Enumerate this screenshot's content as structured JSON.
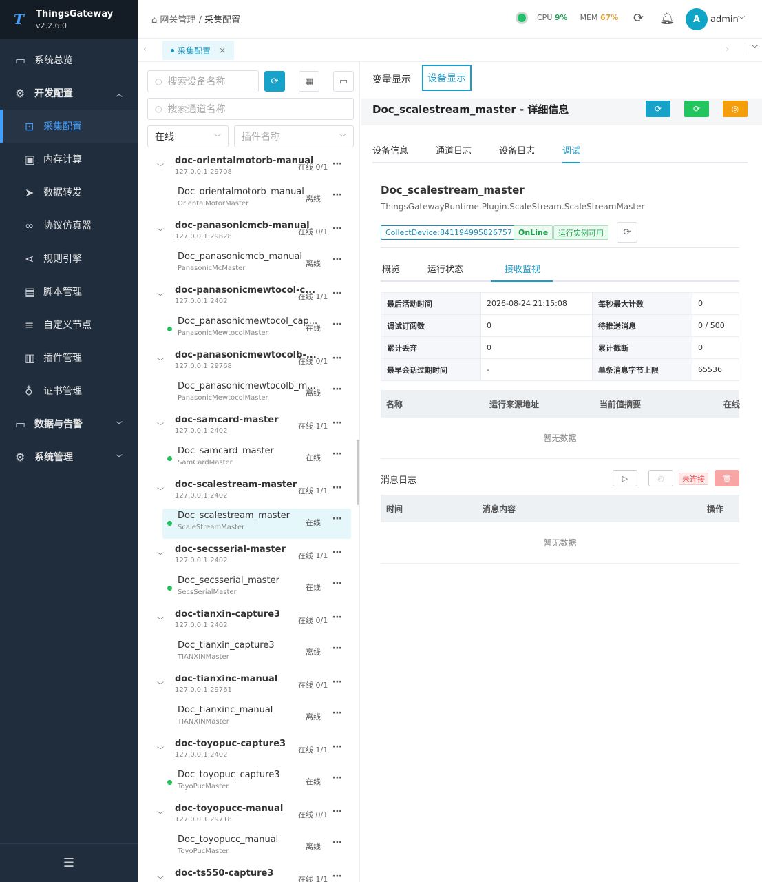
{
  "app": {
    "name": "ThingsGateway",
    "version": "v2.2.6.0",
    "logo": "T"
  },
  "nav": [
    {
      "id": "overview",
      "label": "系统总览",
      "icon": "monitor-icon",
      "level": "top"
    },
    {
      "id": "devconfig",
      "label": "开发配置",
      "icon": "gear-icon",
      "level": "top",
      "expanded": true
    },
    {
      "id": "collect",
      "label": "采集配置",
      "icon": "chart-screen-icon",
      "level": "sub",
      "active": true
    },
    {
      "id": "memcalc",
      "label": "内存计算",
      "icon": "chip-icon",
      "level": "sub"
    },
    {
      "id": "forward",
      "label": "数据转发",
      "icon": "send-icon",
      "level": "sub"
    },
    {
      "id": "simulator",
      "label": "协议仿真器",
      "icon": "link-icon",
      "level": "sub"
    },
    {
      "id": "rules",
      "label": "规则引擎",
      "icon": "share-icon",
      "level": "sub"
    },
    {
      "id": "scripts",
      "label": "脚本管理",
      "icon": "file-icon",
      "level": "sub"
    },
    {
      "id": "customnode",
      "label": "自定义节点",
      "icon": "sliders-icon",
      "level": "sub"
    },
    {
      "id": "plugins",
      "label": "插件管理",
      "icon": "package-icon",
      "level": "sub"
    },
    {
      "id": "certs",
      "label": "证书管理",
      "icon": "stamp-icon",
      "level": "sub"
    },
    {
      "id": "dataalarm",
      "label": "数据与告警",
      "icon": "chart-board-icon",
      "level": "top",
      "collapsed": true
    },
    {
      "id": "sysmgmt",
      "label": "系统管理",
      "icon": "settings-icon",
      "level": "top",
      "collapsed": true
    }
  ],
  "header": {
    "crumb_root": "网关管理",
    "crumb_sep": "/",
    "crumb_current": "采集配置",
    "cpu_label": "CPU",
    "cpu_value": "9%",
    "mem_label": "MEM",
    "mem_value": "67%",
    "user_initial": "A",
    "user_name": "admin"
  },
  "tab": {
    "label": "采集配置"
  },
  "filters": {
    "device_search": "搜索设备名称",
    "channel_search": "搜索通道名称",
    "status_select": "在线",
    "plugin_select": "插件名称"
  },
  "tree": [
    {
      "name": "doc-orientalmotorb-manual",
      "addr": "127.0.0.1:29708",
      "stat": "在线 0/1",
      "dev": {
        "name": "Doc_orientalmotorb_manual",
        "plugin": "OrientalMotorMaster",
        "status": "离线",
        "online": false
      }
    },
    {
      "name": "doc-panasonicmcb-manual",
      "addr": "127.0.0.1:29828",
      "stat": "在线 0/1",
      "dev": {
        "name": "Doc_panasonicmcb_manual",
        "plugin": "PanasonicMcMaster",
        "status": "离线",
        "online": false
      }
    },
    {
      "name": "doc-panasonicmewtocol-c...",
      "addr": "127.0.0.1:2402",
      "stat": "在线 1/1",
      "dev": {
        "name": "Doc_panasonicmewtocol_cap...",
        "plugin": "PanasonicMewtocolMaster",
        "status": "在线",
        "online": true
      }
    },
    {
      "name": "doc-panasonicmewtocolb-...",
      "addr": "127.0.0.1:29768",
      "stat": "在线 0/1",
      "dev": {
        "name": "Doc_panasonicmewtocolb_m...",
        "plugin": "PanasonicMewtocolMaster",
        "status": "离线",
        "online": false
      }
    },
    {
      "name": "doc-samcard-master",
      "addr": "127.0.0.1:2402",
      "stat": "在线 1/1",
      "dev": {
        "name": "Doc_samcard_master",
        "plugin": "SamCardMaster",
        "status": "在线",
        "online": true
      }
    },
    {
      "name": "doc-scalestream-master",
      "addr": "127.0.0.1:2402",
      "stat": "在线 1/1",
      "dev": {
        "name": "Doc_scalestream_master",
        "plugin": "ScaleStreamMaster",
        "status": "在线",
        "online": true,
        "selected": true
      }
    },
    {
      "name": "doc-secsserial-master",
      "addr": "127.0.0.1:2402",
      "stat": "在线 1/1",
      "dev": {
        "name": "Doc_secsserial_master",
        "plugin": "SecsSerialMaster",
        "status": "在线",
        "online": true
      }
    },
    {
      "name": "doc-tianxin-capture3",
      "addr": "127.0.0.1:2402",
      "stat": "在线 0/1",
      "dev": {
        "name": "Doc_tianxin_capture3",
        "plugin": "TIANXINMaster",
        "status": "离线",
        "online": false
      }
    },
    {
      "name": "doc-tianxinc-manual",
      "addr": "127.0.0.1:29761",
      "stat": "在线 0/1",
      "dev": {
        "name": "Doc_tianxinc_manual",
        "plugin": "TIANXINMaster",
        "status": "离线",
        "online": false
      }
    },
    {
      "name": "doc-toyopuc-capture3",
      "addr": "127.0.0.1:2402",
      "stat": "在线 1/1",
      "dev": {
        "name": "Doc_toyopuc_capture3",
        "plugin": "ToyoPucMaster",
        "status": "在线",
        "online": true
      }
    },
    {
      "name": "doc-toyopucc-manual",
      "addr": "127.0.0.1:29718",
      "stat": "在线 0/1",
      "dev": {
        "name": "Doc_toyopucc_manual",
        "plugin": "ToyoPucMaster",
        "status": "离线",
        "online": false
      }
    },
    {
      "name": "doc-ts550-capture3",
      "addr": "",
      "stat": "在线 1/1",
      "dev": null
    }
  ],
  "right": {
    "tabs": [
      "变量显示",
      "设备显示"
    ],
    "detail_title": "Doc_scalestream_master - 详细信息",
    "subtabs": [
      "设备信息",
      "通道日志",
      "设备日志",
      "调试"
    ],
    "device_name": "Doc_scalestream_master",
    "device_plugin": "ThingsGatewayRuntime.Plugin.ScaleStream.ScaleStreamMaster",
    "tags": [
      "CollectDevice:841194995826757",
      "OnLine",
      "运行实例可用"
    ],
    "inner_tabs": [
      "概览",
      "运行状态",
      "接收监视"
    ],
    "kv": [
      [
        "最后活动时间",
        "2026-08-24 21:15:08",
        "每秒最大计数",
        "0"
      ],
      [
        "调试订阅数",
        "0",
        "待推送消息",
        "0 / 500"
      ],
      [
        "累计丢弃",
        "0",
        "累计截断",
        "0"
      ],
      [
        "最早会话过期时间",
        "-",
        "单条消息字节上限",
        "65536"
      ]
    ],
    "table1_cols": [
      "名称",
      "运行来源地址",
      "当前值摘要",
      "在线"
    ],
    "empty_text": "暂无数据",
    "log_label": "消息日志",
    "log_status": "未连接",
    "table2_cols": [
      "时间",
      "消息内容",
      "操作"
    ]
  },
  "colors": {
    "sidebar": "#1f2d3d",
    "accent": "#1d9bc9",
    "online": "#22bf5a",
    "cpu": "#22a45a",
    "mem": "#e6a23c"
  }
}
